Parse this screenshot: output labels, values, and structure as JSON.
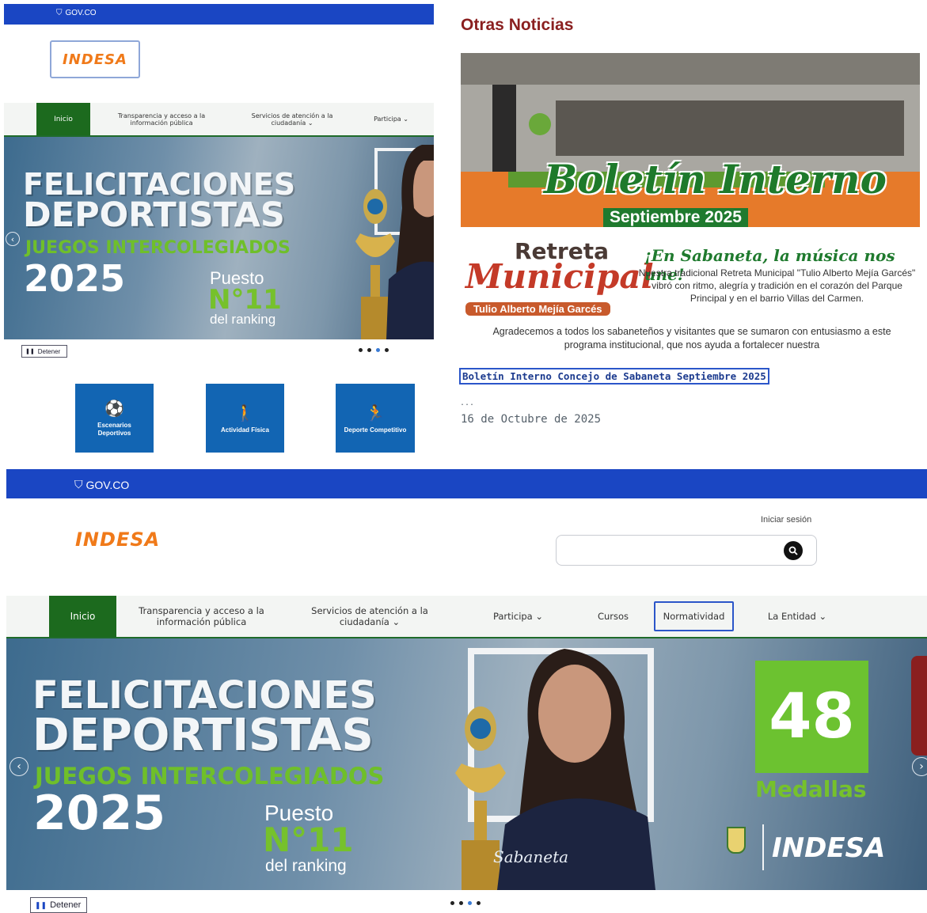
{
  "top_left": {
    "gov_label": "GOV.CO",
    "logo": "INDESA",
    "nav": [
      "Inicio",
      "Transparencia y acceso a la información pública",
      "Servicios de atención a la ciudadanía ⌄",
      "Participa ⌄"
    ],
    "hero": {
      "line1": "FELICITACIONES",
      "line2": "DEPORTISTAS",
      "line3": "JUEGOS INTERCOLEGIADOS",
      "year": "2025",
      "puesto": "Puesto",
      "rank": "N°11",
      "ranking": "del ranking"
    },
    "stop_label": "Detener",
    "tiles": [
      {
        "label": "Escenarios Deportivos",
        "icon": "soccer-ball-icon"
      },
      {
        "label": "Actividad Física",
        "icon": "hiker-icon"
      },
      {
        "label": "Deporte Competitivo",
        "icon": "runners-icon"
      }
    ]
  },
  "news": {
    "heading": "Otras Noticias",
    "image": {
      "title": "Boletín Interno",
      "subtitle": "Septiembre 2025",
      "retreta": "Retreta",
      "municipal": "Municipal",
      "tulio": "Tulio Alberto Mejía Garcés",
      "slogan": "¡En Sabaneta, la música nos une!",
      "desc": "Nuestra tradicional Retreta Municipal \"Tulio Alberto Mejía Garcés\" vibró con ritmo, alegría y tradición en el corazón del Parque Principal y en el barrio Villas del Carmen.",
      "thanks": "Agradecemos a todos los sabaneteños y visitantes que se sumaron con entusiasmo a este programa institucional, que nos ayuda a fortalecer nuestra"
    },
    "link": "Boletín Interno Concejo de Sabaneta Septiembre 2025",
    "ellipsis": "...",
    "date": "16 de Octubre de 2025"
  },
  "bottom": {
    "gov_label": "GOV.CO",
    "logo": "INDESA",
    "login": "Iniciar sesión",
    "search_placeholder": "",
    "nav": [
      "Inicio",
      "Transparencia y acceso a la información pública",
      "Servicios de atención a la ciudadanía ⌄",
      "Participa ⌄",
      "Cursos",
      "Normatividad",
      "La Entidad ⌄"
    ],
    "hero": {
      "line1": "FELICITACIONES",
      "line2": "DEPORTISTAS",
      "line3": "JUEGOS INTERCOLEGIADOS",
      "year": "2025",
      "puesto": "Puesto",
      "rank": "N°11",
      "ranking": "del ranking",
      "medals_count": "48",
      "medals_label": "Medallas",
      "brand": "INDESA",
      "shirt": "Sabaneta"
    },
    "stop_label": "Detener"
  },
  "colors": {
    "gov_blue": "#1a46c3",
    "nav_green": "#1c6a1e",
    "brand_orange": "#f07a1a",
    "tile_blue": "#1265b3",
    "news_red": "#8a1f1f"
  }
}
